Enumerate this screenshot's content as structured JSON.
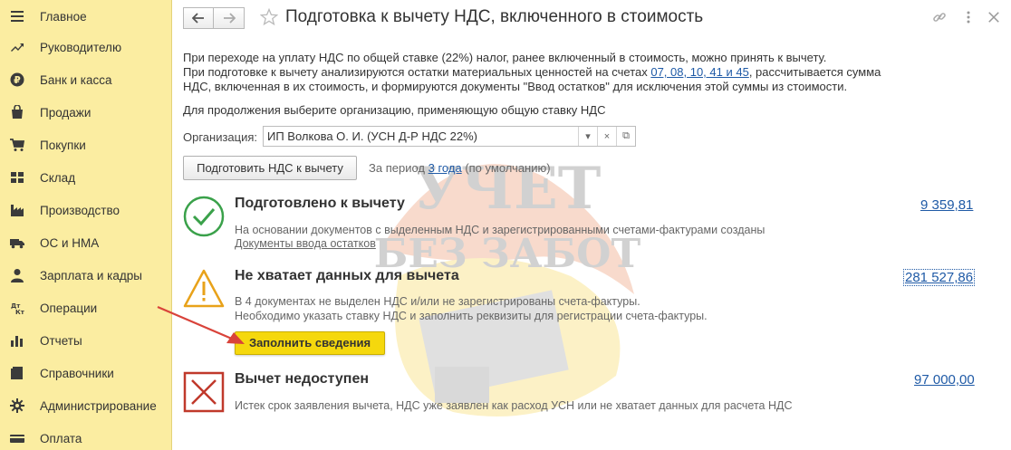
{
  "sidebar": {
    "items": [
      {
        "label": "Главное",
        "icon": "menu-icon"
      },
      {
        "label": "Руководителю",
        "icon": "trend-icon"
      },
      {
        "label": "Банк и касса",
        "icon": "ruble-icon"
      },
      {
        "label": "Продажи",
        "icon": "bag-icon"
      },
      {
        "label": "Покупки",
        "icon": "cart-icon"
      },
      {
        "label": "Склад",
        "icon": "warehouse-icon"
      },
      {
        "label": "Производство",
        "icon": "factory-icon"
      },
      {
        "label": "ОС и НМА",
        "icon": "truck-icon"
      },
      {
        "label": "Зарплата и кадры",
        "icon": "person-icon"
      },
      {
        "label": "Операции",
        "icon": "debit-credit-icon"
      },
      {
        "label": "Отчеты",
        "icon": "bar-chart-icon"
      },
      {
        "label": "Справочники",
        "icon": "book-icon"
      },
      {
        "label": "Администрирование",
        "icon": "gear-icon"
      },
      {
        "label": "Оплата",
        "icon": "payment-icon"
      }
    ]
  },
  "header": {
    "title": "Подготовка к вычету НДС, включенного в стоимость"
  },
  "intro": {
    "line1": "При переходе на уплату НДС по общей ставке (22%) налог, ранее включенный в стоимость, можно принять к вычету.",
    "line2_pre": "При подготовке к вычету анализируются остатки материальных ценностей на счетах ",
    "line2_link": "07, 08, 10, 41 и 45",
    "line2_post": ", рассчитывается сумма",
    "line3": "НДС, включенная в их стоимость, и формируются документы \"Ввод остатков\" для исключения этой суммы из стоимости."
  },
  "choose_text": "Для продолжения выберите организацию, применяющую общую ставку НДС",
  "org": {
    "label": "Организация:",
    "value": "ИП Волкова О. И. (УСН Д-Р НДС 22%)"
  },
  "prepare": {
    "button": "Подготовить НДС к вычету",
    "period_pre": "За период",
    "period_link": "3 года",
    "period_post": "(по умолчанию)"
  },
  "sections": {
    "ready": {
      "title": "Подготовлено к вычету",
      "amount": "9 359,81",
      "text": "На основании документов с выделенным НДС и зарегистрированными счетами-фактурами созданы",
      "link": "Документы ввода остатков"
    },
    "missing": {
      "title": "Не хватает данных для вычета",
      "amount": "281 527,86",
      "text1": "В 4 документах не выделен НДС и/или не зарегистрированы счета-фактуры.",
      "text2": "Необходимо указать ставку НДС и заполнить реквизиты для регистрации счета-фактуры.",
      "button": "Заполнить сведения"
    },
    "unavailable": {
      "title": "Вычет недоступен",
      "amount": "97 000,00",
      "text": "Истек срок заявления вычета, НДС уже заявлен как расход УСН или не хватает данных для расчета НДС"
    }
  },
  "watermark": {
    "line1": "УЧЕТ",
    "line2": "БЕЗ ЗАБОТ"
  },
  "colors": {
    "sidebar_bg": "#fbeda1",
    "link": "#1f5aa6",
    "accent_button": "#f5d80d",
    "ok_green": "#3aa14a",
    "warn_orange": "#e8a21a",
    "error_red": "#c0392b"
  }
}
